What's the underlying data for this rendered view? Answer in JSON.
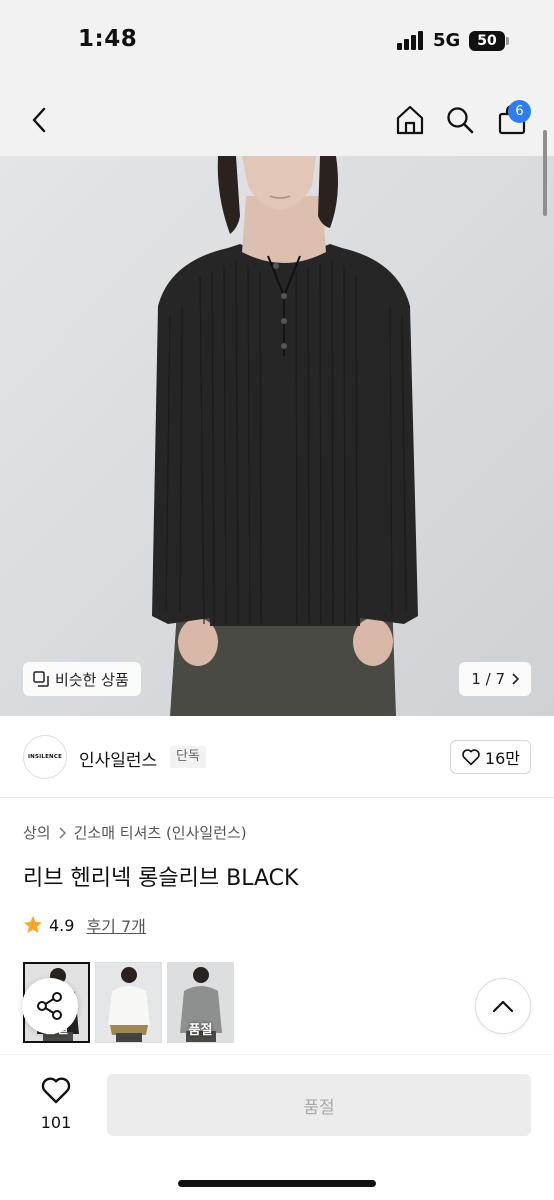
{
  "status_bar": {
    "time": "1:48",
    "network": "5G",
    "battery": "50"
  },
  "nav": {
    "cart_badge": "6"
  },
  "gallery": {
    "similar_label": "비슷한 상품",
    "page_indicator": "1 / 7"
  },
  "brand": {
    "logo_text": "INSILENCE",
    "name": "인사일런스",
    "tag": "단독",
    "likes": "16만"
  },
  "breadcrumb": {
    "level1": "상의",
    "level2": "긴소매 티셔츠 (인사일런스)"
  },
  "product": {
    "title": "리브 헨리넥 롱슬리브 BLACK"
  },
  "rating": {
    "score": "4.9",
    "reviews": "후기 7개"
  },
  "thumbnails": [
    {
      "label": "품절",
      "color": "black"
    },
    {
      "label": "",
      "color": "white"
    },
    {
      "label": "품절",
      "color": "gray"
    }
  ],
  "bottom": {
    "wish_count": "101",
    "buy_label": "품절"
  },
  "colors": {
    "accent": "#2f7df6",
    "star": "#f5a623"
  }
}
